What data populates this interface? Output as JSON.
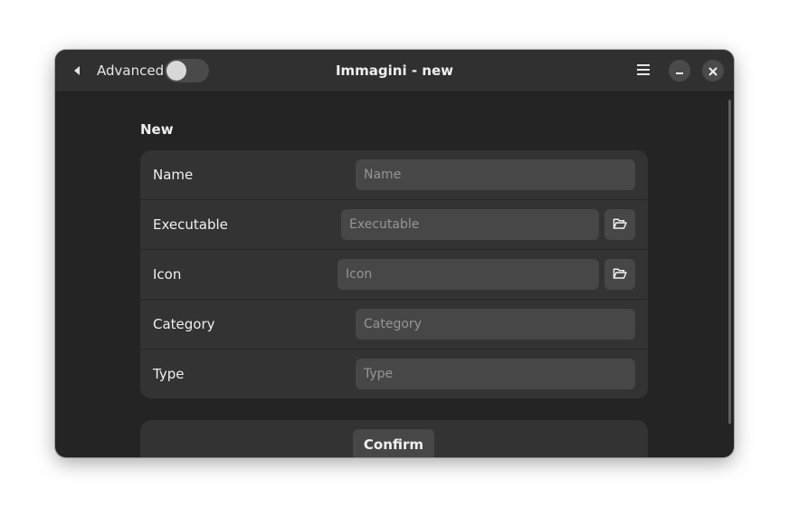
{
  "window": {
    "title": "Immagini - new"
  },
  "header": {
    "advanced_label": "Advanced",
    "advanced_enabled": false,
    "back_icon": "back-arrow-icon",
    "menu_icon": "hamburger-menu-icon",
    "minimize_icon": "minimize-icon",
    "close_icon": "close-icon"
  },
  "form": {
    "section_title": "New",
    "rows": [
      {
        "label": "Name",
        "value": "",
        "placeholder": "Name",
        "has_file_picker": false
      },
      {
        "label": "Executable",
        "value": "",
        "placeholder": "Executable",
        "has_file_picker": true
      },
      {
        "label": "Icon",
        "value": "",
        "placeholder": "Icon",
        "has_file_picker": true
      },
      {
        "label": "Category",
        "value": "",
        "placeholder": "Category",
        "has_file_picker": false
      },
      {
        "label": "Type",
        "value": "",
        "placeholder": "Type",
        "has_file_picker": false
      }
    ],
    "file_picker_icon": "folder-open-icon",
    "confirm_label": "Confirm"
  },
  "colors": {
    "window_bg": "#242424",
    "headerbar_bg": "#303030",
    "card_bg": "#333333",
    "entry_bg": "#474747",
    "text": "#f0f0f0",
    "placeholder": "#969696"
  }
}
